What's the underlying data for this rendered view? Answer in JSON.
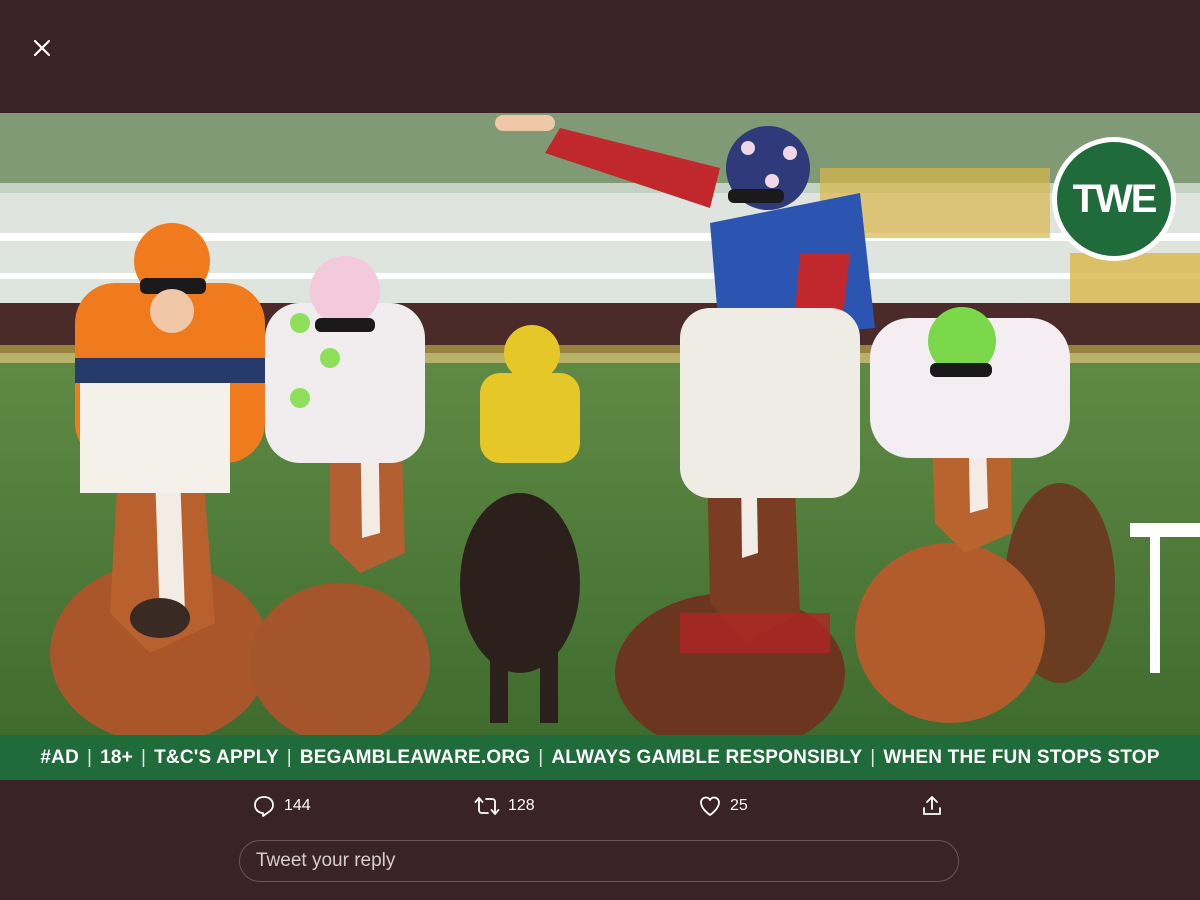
{
  "viewer": {
    "close_icon": "close-icon"
  },
  "media": {
    "logo_text": "TWE",
    "ad_banner": [
      "#AD",
      "18+",
      "T&C'S APPLY",
      "BEGAMBLEAWARE.ORG",
      "ALWAYS GAMBLE RESPONSIBLY",
      "WHEN THE FUN STOPS STOP"
    ],
    "colors": {
      "banner_green": "#1f6b3a",
      "background": "#3a2326"
    }
  },
  "actions": {
    "reply": {
      "icon": "reply-icon",
      "count": "144"
    },
    "retweet": {
      "icon": "retweet-icon",
      "count": "128"
    },
    "like": {
      "icon": "heart-icon",
      "count": "25"
    },
    "share": {
      "icon": "share-icon"
    }
  },
  "reply": {
    "placeholder": "Tweet your reply",
    "value": ""
  }
}
